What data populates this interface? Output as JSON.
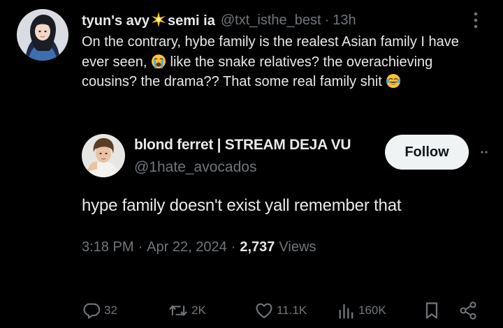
{
  "reply": {
    "name_part1": "tyun's avy",
    "name_part2": "semi ia",
    "handle": "@txt_isthe_best",
    "time": "13h",
    "text_before_emoji1": "On the contrary, hybe family is the realest Asian family I have ever seen, ",
    "text_between": " like the snake relatives? the overachieving cousins? the drama?? That some real family shit ",
    "emoji1": "crying-face",
    "emoji2": "tears-of-joy-face"
  },
  "tweet": {
    "name": "blond ferret | STREAM DEJA VU",
    "handle": "@1hate_avocados",
    "follow_label": "Follow",
    "text": "hype family doesn't exist yall remember that",
    "time": "3:18 PM",
    "date": "Apr 22, 2024",
    "views_count": "2,737",
    "views_label": "Views"
  },
  "actions": {
    "replies": "32",
    "reposts": "2K",
    "likes": "11.1K",
    "views": "160K"
  },
  "colors": {
    "background": "#000000",
    "text": "#e7e9ea",
    "muted": "#71767b",
    "follow_bg": "#eff3f4"
  }
}
